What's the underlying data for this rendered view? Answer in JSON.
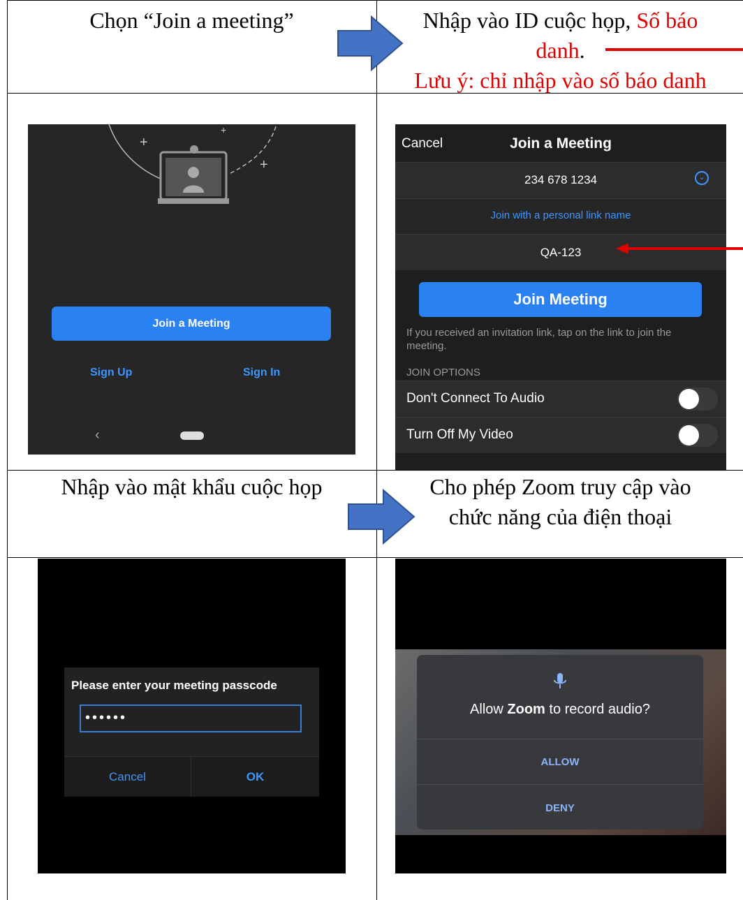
{
  "cells": {
    "top_left": "Chọn “Join a meeting”",
    "top_right_line1_black": "Nhập vào ID cuộc họp, ",
    "top_right_line1_red": "Số báo",
    "top_right_line2_red": "danh",
    "top_right_line2_dot": ".",
    "top_right_note": "Lưu ý: chỉ nhập vào số báo danh",
    "mid_left": "Nhập vào mật khẩu cuộc họp",
    "mid_right_line1": "Cho phép Zoom truy cập vào",
    "mid_right_line2": "chức năng của điện thoại"
  },
  "screen1": {
    "join_button": "Join a Meeting",
    "sign_up": "Sign Up",
    "sign_in": "Sign In",
    "back_glyph": "‹"
  },
  "screen2": {
    "cancel": "Cancel",
    "title": "Join a Meeting",
    "meeting_id": "234 678 1234",
    "personal_link": "Join with a personal link name",
    "name_value": "QA-123",
    "join_button": "Join Meeting",
    "hint": "If you received an invitation link, tap on the link to join the meeting.",
    "options_header": "JOIN OPTIONS",
    "option_audio": "Don't Connect To Audio",
    "option_video": "Turn Off My Video"
  },
  "screen3": {
    "dialog_title": "Please enter your meeting passcode",
    "passcode_masked": "••••••",
    "cancel": "Cancel",
    "ok": "OK"
  },
  "screen4": {
    "question_pre": "Allow ",
    "question_app": "Zoom",
    "question_post": " to record audio?",
    "allow": "ALLOW",
    "deny": "DENY"
  },
  "colors": {
    "accent_blue": "#2a82f2",
    "link_blue": "#3e96ff",
    "note_red": "#e00000",
    "arrow_blue": "#4472c4"
  }
}
